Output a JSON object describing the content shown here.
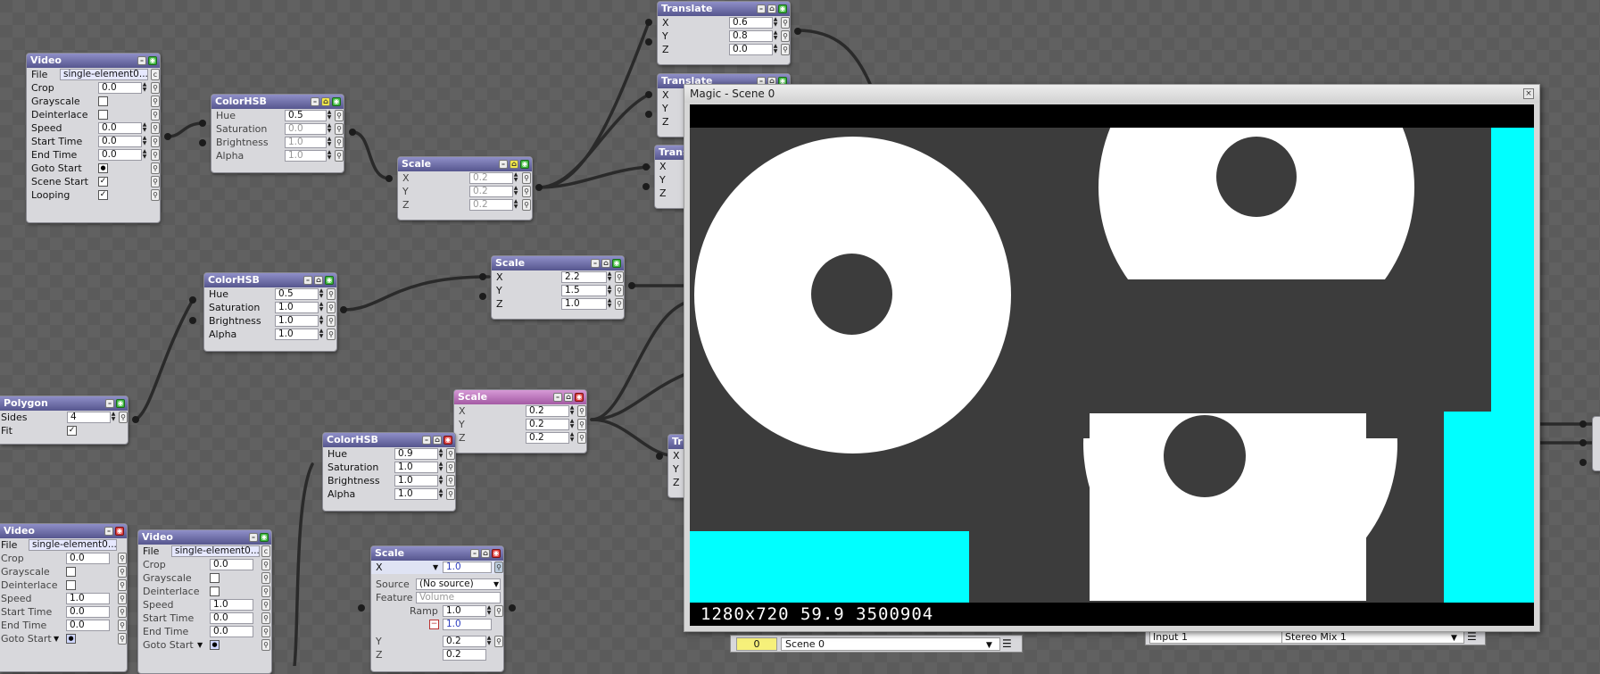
{
  "nodes": {
    "video1": {
      "title": "Video",
      "file": "single-element0...",
      "crop": "0.0",
      "speed": "0.0",
      "start_time": "0.0",
      "end_time": "0.0"
    },
    "colorhsb1": {
      "title": "ColorHSB",
      "hue": "0.5",
      "saturation": "0.0",
      "brightness": "1.0",
      "alpha": "1.0"
    },
    "scale1": {
      "title": "Scale",
      "x": "0.2",
      "y": "0.2",
      "z": "0.2"
    },
    "translate1": {
      "title": "Translate",
      "x": "0.6",
      "y": "0.8",
      "z": "0.0"
    },
    "translate2": {
      "title": "Translate",
      "x": "X",
      "y": "Y",
      "z": "Z"
    },
    "translate3": {
      "title": "Trans",
      "x": "X",
      "y": "Y",
      "z": "Z"
    },
    "colorhsb2": {
      "title": "ColorHSB",
      "hue": "0.5",
      "saturation": "1.0",
      "brightness": "1.0",
      "alpha": "1.0"
    },
    "scale2": {
      "title": "Scale",
      "x": "2.2",
      "y": "1.5",
      "z": "1.0"
    },
    "polygon": {
      "title": "Polygon",
      "sides": "4"
    },
    "scale3": {
      "title": "Scale",
      "x": "0.2",
      "y": "0.2",
      "z": "0.2"
    },
    "colorhsb3": {
      "title": "ColorHSB",
      "hue": "0.9",
      "saturation": "1.0",
      "brightness": "1.0",
      "alpha": "1.0"
    },
    "translate4": {
      "title": "Tr",
      "x": "X",
      "y": "Y",
      "z": "Z"
    },
    "video2": {
      "title": "Video",
      "file": "single-element0...",
      "crop": "0.0",
      "speed": "1.0",
      "start_time": "0.0",
      "end_time": "0.0"
    },
    "video3": {
      "title": "Video",
      "file": "single-element0...",
      "crop": "0.0",
      "speed": "1.0",
      "start_time": "0.0",
      "end_time": "0.0"
    },
    "scale4": {
      "title": "Scale",
      "x_label": "X",
      "x": "1.0",
      "source_label": "Source",
      "source": "(No source)",
      "feature_label": "Feature",
      "feature": "Volume",
      "ramp_label": "Ramp",
      "ramp": "1.0",
      "ramp2": "1.0",
      "y": "0.2",
      "z": "0.2"
    }
  },
  "labels": {
    "file": "File",
    "crop": "Crop",
    "grayscale": "Grayscale",
    "deinterlace": "Deinterlace",
    "speed": "Speed",
    "start_time": "Start Time",
    "end_time": "End Time",
    "goto_start": "Goto Start",
    "scene_start": "Scene Start",
    "looping": "Looping",
    "hue": "Hue",
    "saturation": "Saturation",
    "brightness": "Brightness",
    "alpha": "Alpha",
    "x": "X",
    "y": "Y",
    "z": "Z",
    "sides": "Sides",
    "fit": "Fit"
  },
  "magic_window": {
    "title": "Magic - Scene 0",
    "stats": "1280x720  59.9  3500904"
  },
  "scene_bar": {
    "number": "0",
    "scene": "Scene 0"
  },
  "audio_bar": {
    "input": "Input 1",
    "device": "Stereo Mix 1"
  },
  "colors": {
    "accent_header": "#56568e",
    "pink_header": "#a45aa4",
    "cyan": "#00ffff",
    "scene_bg": "#3c3c3c"
  }
}
